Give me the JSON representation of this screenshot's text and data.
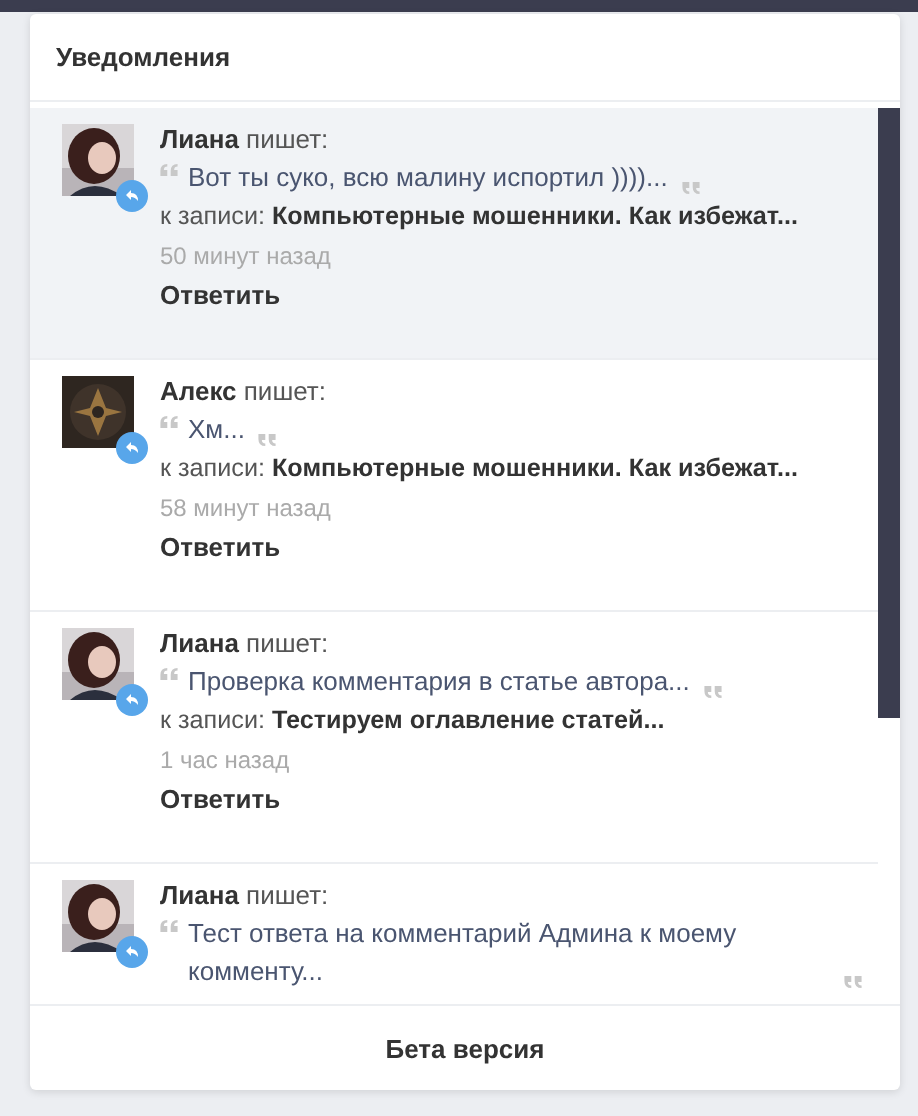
{
  "panel": {
    "title": "Уведомления",
    "footer": "Бета версия"
  },
  "notifications": [
    {
      "author": "Лиана",
      "verb": "пишет:",
      "quote": "Вот ты суко, всю малину испортил ))))...",
      "record_label": "к записи:",
      "record": "Компьютерные мошенники. Как избежат...",
      "time": "50 минут назад",
      "reply": "Ответить",
      "unread": true,
      "avatar": {
        "kind": "person"
      }
    },
    {
      "author": "Алекс",
      "verb": "пишет:",
      "quote": "Хм...",
      "record_label": "к записи:",
      "record": "Компьютерные мошенники. Как избежат...",
      "time": "58 минут назад",
      "reply": "Ответить",
      "unread": false,
      "avatar": {
        "kind": "emblem"
      }
    },
    {
      "author": "Лиана",
      "verb": "пишет:",
      "quote": "Проверка комментария в статье автора...",
      "record_label": "к записи:",
      "record": "Тестируем оглавление статей...",
      "time": "1 час назад",
      "reply": "Ответить",
      "unread": false,
      "avatar": {
        "kind": "person"
      }
    },
    {
      "author": "Лиана",
      "verb": "пишет:",
      "quote": "Тест ответа на комментарий Админа к моему комменту...",
      "unread": false,
      "avatar": {
        "kind": "person"
      }
    }
  ]
}
